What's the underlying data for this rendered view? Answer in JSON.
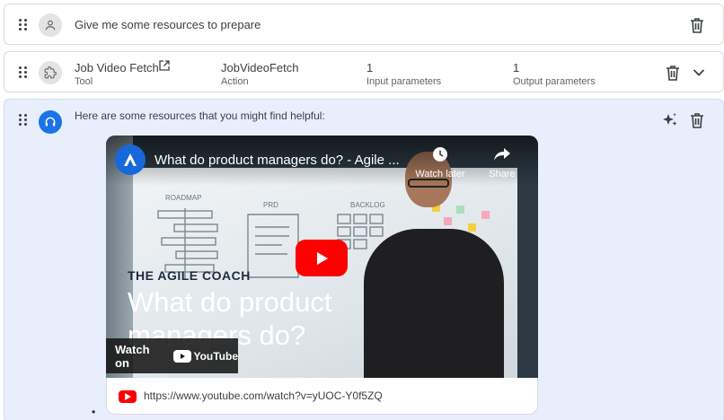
{
  "row1": {
    "message": "Give me some resources to prepare"
  },
  "row2": {
    "tool_name": "Job Video Fetch",
    "tool_type": "Tool",
    "action_value": "JobVideoFetch",
    "action_label": "Action",
    "input_count": "1",
    "input_label": "Input parameters",
    "output_count": "1",
    "output_label": "Output parameters"
  },
  "row3": {
    "message": "Here are some resources that you might find helpful:"
  },
  "video": {
    "title": "What do product managers do? - Agile ...",
    "watch_later": "Watch later",
    "share": "Share",
    "overlay_kicker": "THE AGILE COACH",
    "overlay_line1": "What do product",
    "overlay_line2": "managers do?",
    "watch_on": "Watch on",
    "youtube_brand": "YouTube",
    "link_url": "https://www.youtube.com/watch?v=yUOC-Y0f5ZQ",
    "wb_roadmap": "ROADMAP",
    "wb_prd": "PRD",
    "wb_backlog": "BACKLOG"
  },
  "bullet": "•",
  "colors": {
    "highlight_bg": "#e8eefc",
    "agent_avatar": "#1a73e8",
    "youtube_red": "#ff0000"
  }
}
